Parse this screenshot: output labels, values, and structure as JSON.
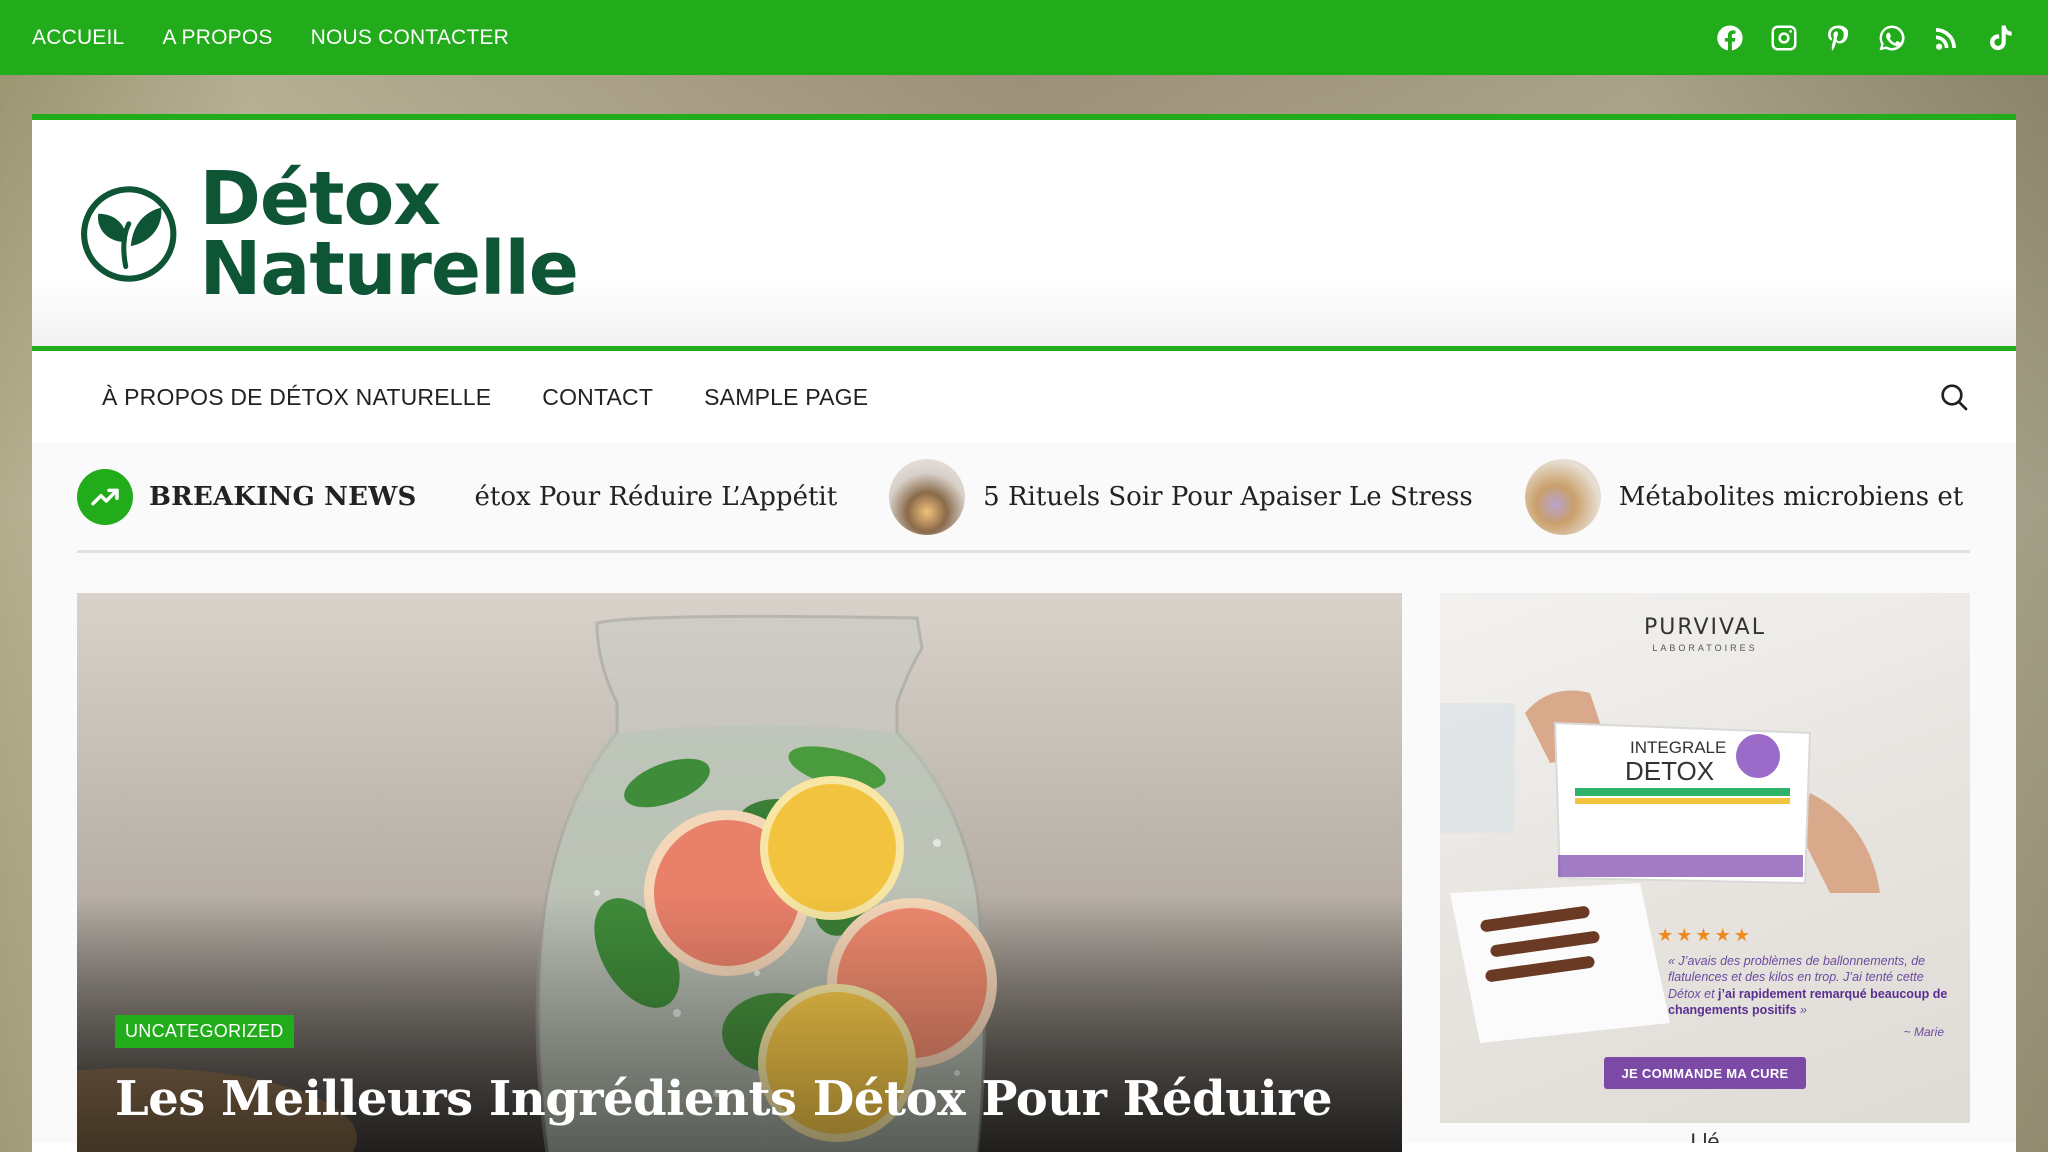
{
  "topbar": {
    "nav": [
      "ACCUEIL",
      "A PROPOS",
      "NOUS CONTACTER"
    ],
    "social_icons": [
      "facebook-icon",
      "instagram-icon",
      "pinterest-icon",
      "whatsapp-icon",
      "rss-icon",
      "tiktok-icon"
    ],
    "background": "#22ab1b"
  },
  "logo": {
    "line1": "Détox",
    "line2": "Naturelle",
    "color": "#0e5535"
  },
  "mainnav": {
    "items": [
      "À PROPOS DE DÉTOX NATURELLE",
      "CONTACT",
      "SAMPLE PAGE"
    ]
  },
  "ticker": {
    "label": "BREAKING NEWS",
    "items": [
      "étox Pour Réduire L’Appétit",
      "5 Rituels Soir Pour Apaiser Le Stress",
      "Métabolites microbiens et régulation"
    ]
  },
  "hero": {
    "category": "UNCATEGORIZED",
    "title": "Les Meilleurs Ingrédients Détox Pour Réduire"
  },
  "ad": {
    "brand": "PURVIVAL",
    "brand_sub": "LABORATOIRES",
    "product_line1": "INTEGRALE",
    "product_line2": "DETOX",
    "stars": "★★★★★",
    "quote_part1": "« J’avais des problèmes de ballonnements, de flatulences et des kilos en trop. J’ai tenté cette Détox et",
    "quote_bold": "j’ai rapidement remarqué beaucoup de changements positifs",
    "quote_end": "»",
    "author": "~ Marie",
    "cta": "JE COMMANDE MA CURE",
    "caption": "Llé"
  }
}
